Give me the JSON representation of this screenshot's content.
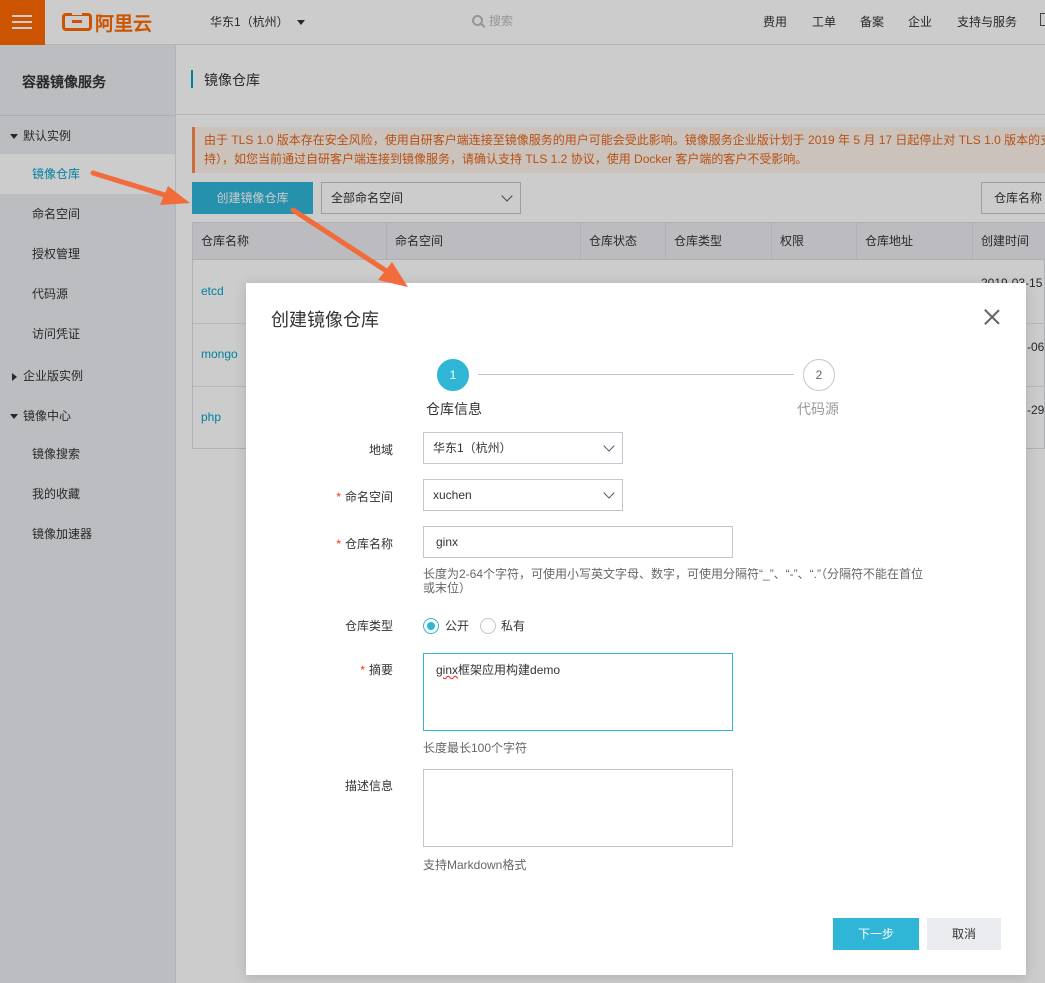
{
  "header": {
    "logo_text": "阿里云",
    "region": "华东1（杭州）",
    "search_placeholder": "搜索",
    "nav": [
      "费用",
      "工单",
      "备案",
      "企业",
      "支持与服务"
    ]
  },
  "sidebar": {
    "title": "容器镜像服务",
    "groups": [
      {
        "label": "默认实例",
        "expanded": true
      },
      {
        "label": "企业版实例",
        "expanded": false
      },
      {
        "label": "镜像中心",
        "expanded": true
      }
    ],
    "items": [
      "镜像仓库",
      "命名空间",
      "授权管理",
      "代码源",
      "访问凭证",
      "镜像搜索",
      "我的收藏",
      "镜像加速器"
    ],
    "active_item": "镜像仓库"
  },
  "main": {
    "title": "镜像仓库",
    "notice_line1": "由于 TLS 1.0 版本存在安全风险，使用自研客户端连接至镜像服务的用户可能会受此影响。镜像服务企业版计划于 2019 年 5 月 17 日起停止对 TLS 1.0 版本的支",
    "notice_line2": "持），如您当前通过自研客户端连接到镜像服务，请确认支持 TLS 1.2 协议，使用 Docker 客户端的客户不受影响。",
    "create_button": "创建镜像仓库",
    "namespace_filter": "全部命名空间",
    "repo_name_filter": "仓库名称",
    "table": {
      "columns": [
        "仓库名称",
        "命名空间",
        "仓库状态",
        "仓库类型",
        "权限",
        "仓库地址",
        "创建时间"
      ],
      "rows": [
        {
          "name": "etcd",
          "time": "2019-03-15"
        },
        {
          "name": "mongo",
          "time": "-06"
        },
        {
          "name": "php",
          "time": "-29"
        }
      ]
    }
  },
  "modal": {
    "title": "创建镜像仓库",
    "steps": [
      {
        "num": "1",
        "label": "仓库信息"
      },
      {
        "num": "2",
        "label": "代码源"
      }
    ],
    "region_label": "地域",
    "region_value": "华东1（杭州）",
    "namespace_label": "命名空间",
    "namespace_value": "xuchen",
    "repo_name_label": "仓库名称",
    "repo_name_value": "ginx",
    "repo_name_hint_1": "长度为2-64个字符，可使用小写英文字母、数字，可使用分隔符“_”、“-”、“.”（分隔符不能在首位",
    "repo_name_hint_2": "或末位）",
    "repo_type_label": "仓库类型",
    "repo_type_public": "公开",
    "repo_type_private": "私有",
    "summary_label": "摘要",
    "summary_value_word": "ginx",
    "summary_value_rest": "框架应用构建demo",
    "summary_hint": "长度最长100个字符",
    "description_label": "描述信息",
    "description_hint": "支持Markdown格式",
    "next_button": "下一步",
    "cancel_button": "取消"
  },
  "colors": {
    "brand": "#ff6a00",
    "primary": "#2fb6d7",
    "link": "#00a2ca",
    "annotation_arrow": "#f26b3a"
  }
}
